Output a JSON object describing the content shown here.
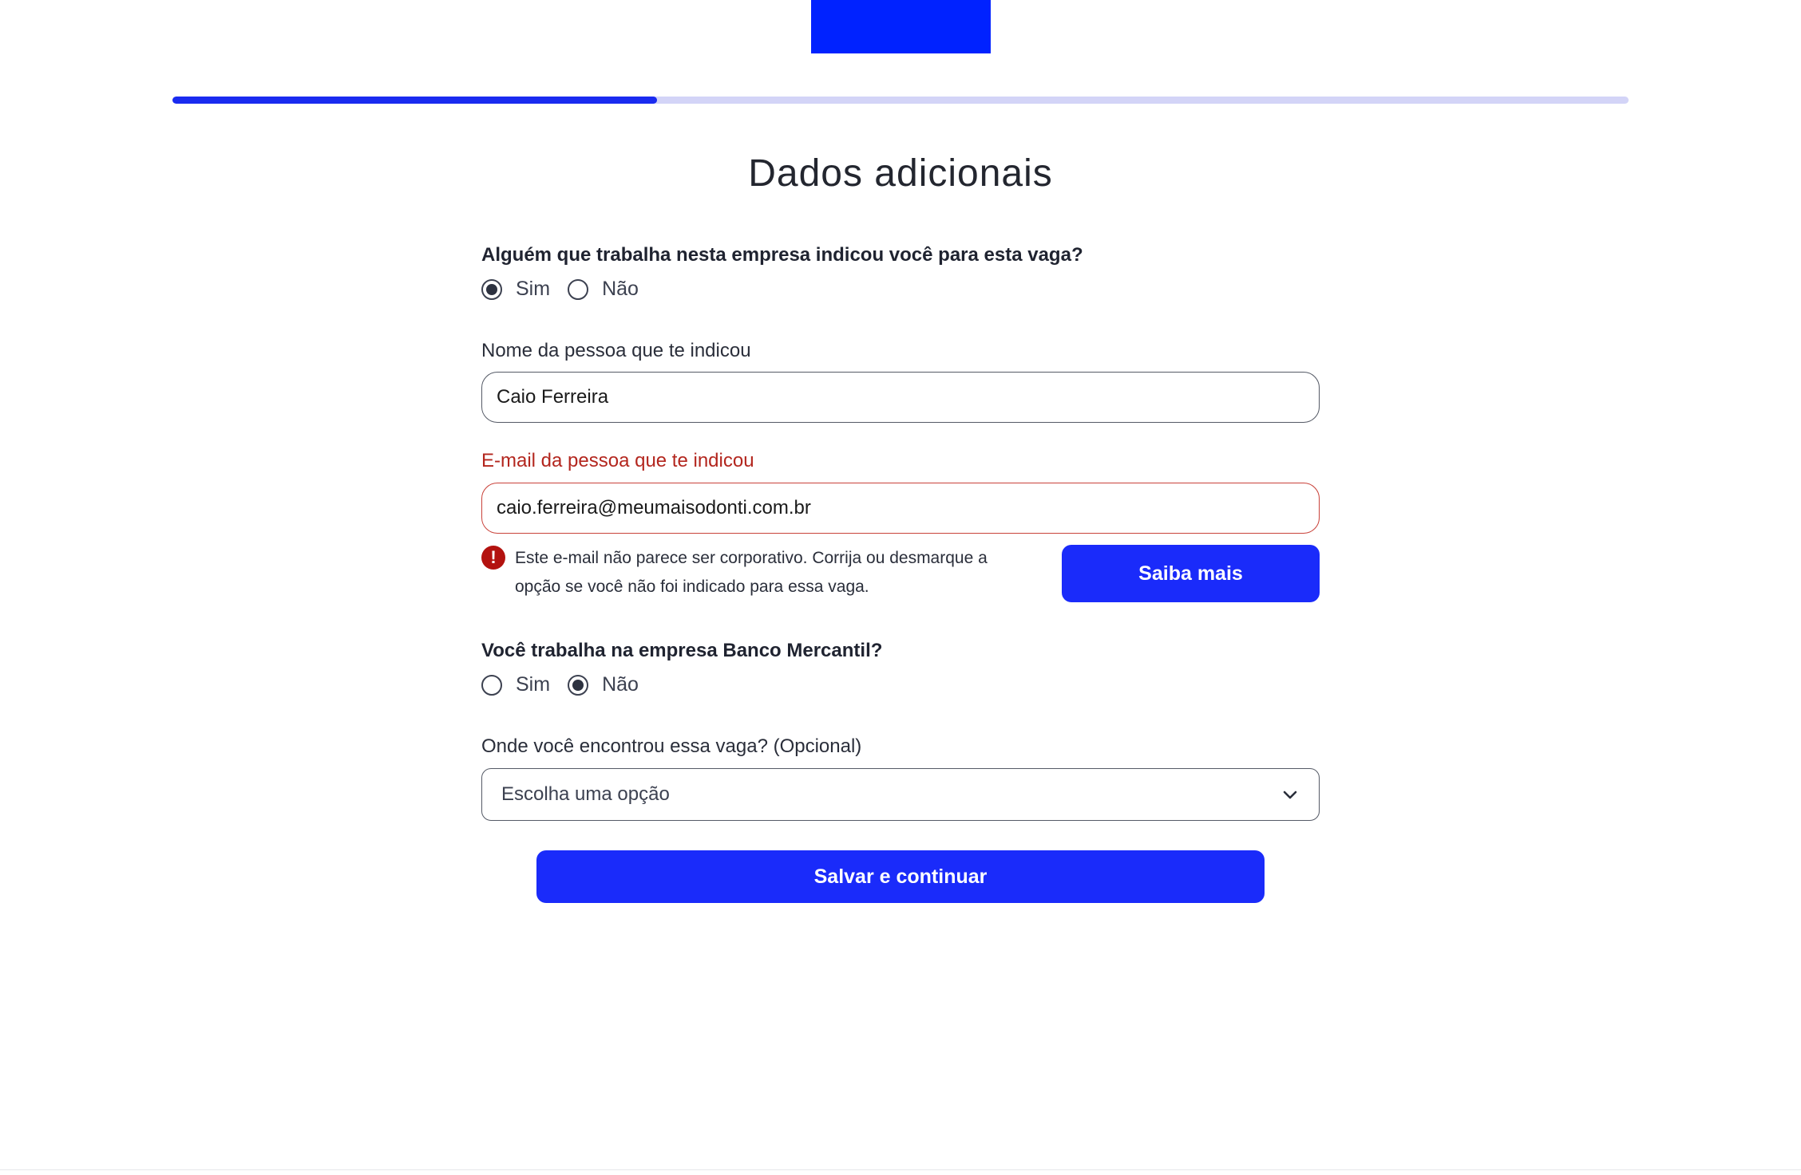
{
  "colors": {
    "brand": "#0022ff",
    "primary_button": "#1a2bfa",
    "progress_fill": "#1a2bf0",
    "progress_track": "#d3d4f7",
    "error": "#b3261e"
  },
  "progress": {
    "percent": 33.3
  },
  "page_title": "Dados adicionais",
  "referral_question": {
    "label": "Alguém que trabalha nesta empresa indicou você para esta vaga?",
    "options": [
      "Sim",
      "Não"
    ],
    "selected": "Sim"
  },
  "referrer_name": {
    "label": "Nome da pessoa que te indicou",
    "value": "Caio Ferreira"
  },
  "referrer_email": {
    "label": "E-mail da pessoa que te indicou",
    "value": "caio.ferreira@meumaisodonti.com.br",
    "error_icon": "exclamation-icon",
    "error_message": "Este e-mail não parece ser corporativo. Corrija ou desmarque a opção se você não foi indicado para essa vaga.",
    "learn_more_label": "Saiba mais"
  },
  "employee_question": {
    "label": "Você trabalha na empresa Banco Mercantil?",
    "options": [
      "Sim",
      "Não"
    ],
    "selected": "Não"
  },
  "source": {
    "label": "Onde você encontrou essa vaga? (Opcional)",
    "selected_text": "Escolha uma opção",
    "icon": "chevron-down-icon"
  },
  "submit_label": "Salvar e continuar"
}
